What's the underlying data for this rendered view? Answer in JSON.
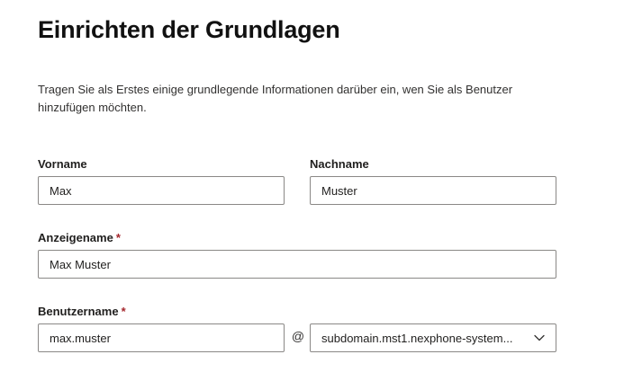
{
  "page": {
    "title": "Einrichten der Grundlagen",
    "description": "Tragen Sie als Erstes einige grundlegende Informationen darüber ein, wen Sie als Benutzer hinzufügen möchten."
  },
  "form": {
    "first_name": {
      "label": "Vorname",
      "value": "Max"
    },
    "last_name": {
      "label": "Nachname",
      "value": "Muster"
    },
    "display_name": {
      "label": "Anzeigename",
      "required_mark": "*",
      "value": "Max Muster"
    },
    "username": {
      "label": "Benutzername",
      "required_mark": "*",
      "value": "max.muster",
      "at_symbol": "@",
      "domain_selected": "subdomain.mst1.nexphone-system..."
    }
  },
  "icons": {
    "domain_dropdown": "chevron-down-icon"
  }
}
